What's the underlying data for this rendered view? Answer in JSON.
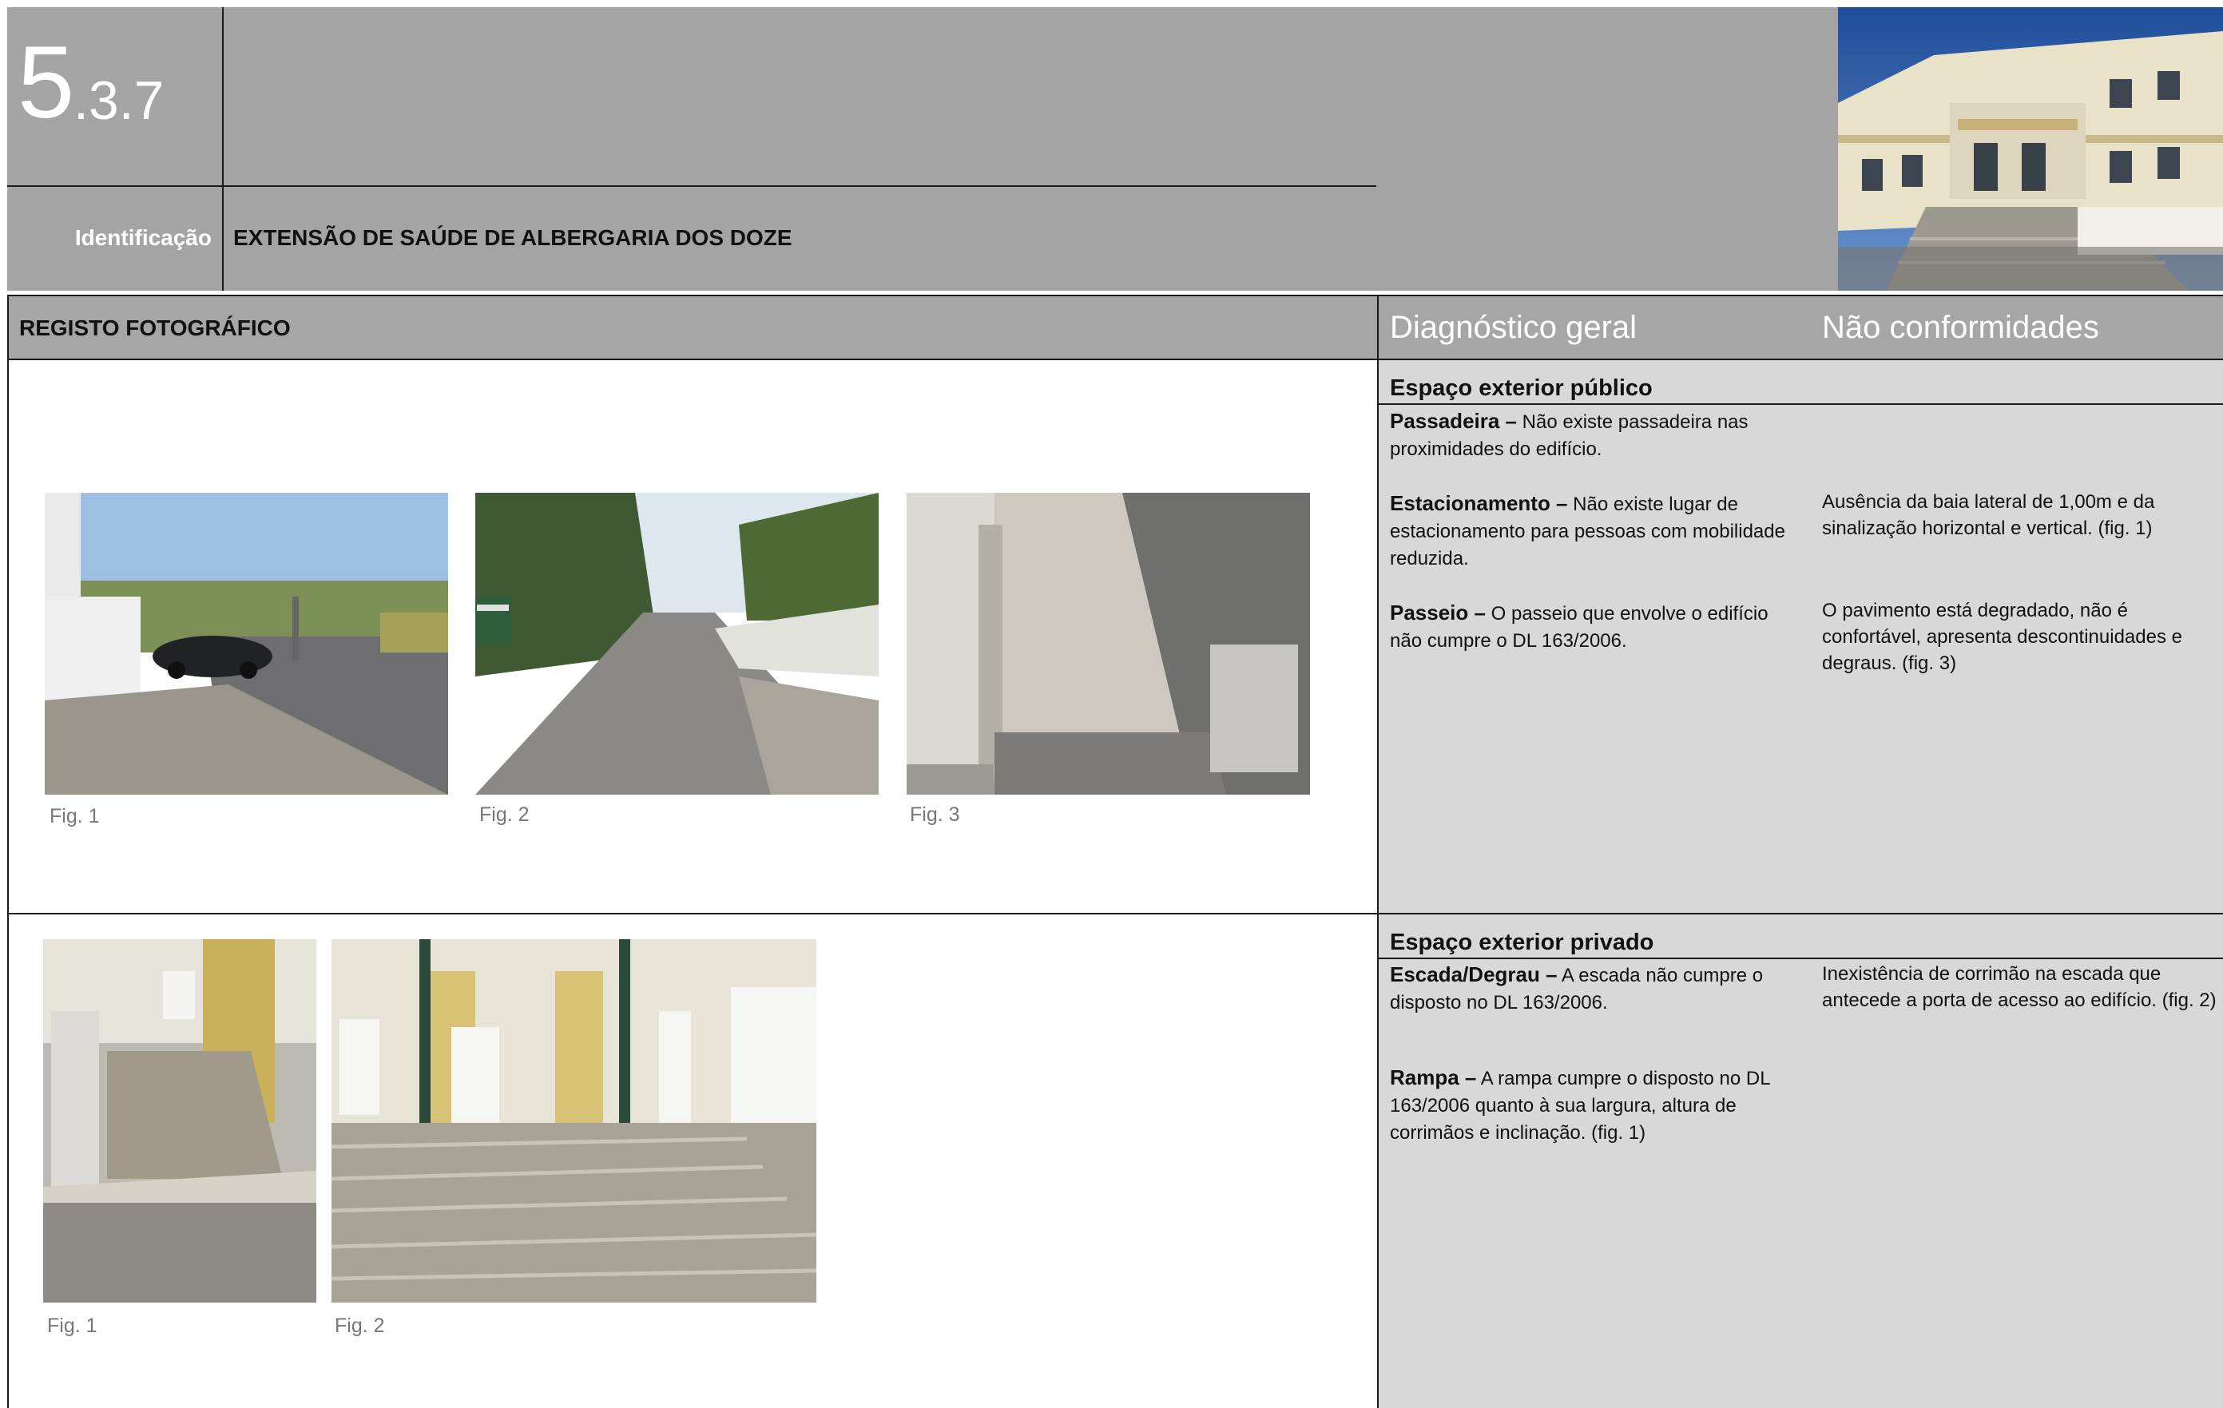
{
  "header": {
    "section_number": "5",
    "section_sub": ".3.7",
    "identification_label": "Identificação",
    "identification_value": "EXTENSÃO DE SAÚDE DE ALBERGARIA DOS DOZE"
  },
  "table": {
    "photo_column_title": "REGISTO FOTOGRÁFICO",
    "diagnosis_column_title": "Diagnóstico geral",
    "nonconformity_column_title": "Não conformidades"
  },
  "public_section": {
    "title": "Espaço exterior público",
    "items": [
      {
        "term": "Passadeira –",
        "text": " Não existe passadeira nas proximidades do edifício.",
        "nonconformity": ""
      },
      {
        "term": "Estacionamento –",
        "text": " Não existe lugar de estacionamento para pessoas com mobilidade reduzida.",
        "nonconformity": "Ausência da baia lateral de 1,00m e da sinalização horizontal e vertical. (fig. 1)"
      },
      {
        "term": "Passeio –",
        "text": " O passeio que envolve o edifício não cumpre o DL 163/2006.",
        "nonconformity": "O pavimento está degradado, não é confortável, apresenta descontinuidades e degraus. (fig. 3)"
      }
    ],
    "figures": [
      "Fig. 1",
      "Fig. 2",
      "Fig. 3"
    ]
  },
  "private_section": {
    "title": "Espaço exterior privado",
    "items": [
      {
        "term": "Escada/Degrau –",
        "text": " A escada não cumpre o disposto no DL 163/2006.",
        "nonconformity": "Inexistência de corrimão na escada que antecede a porta de acesso ao edifício. (fig. 2)"
      },
      {
        "term": "Rampa –",
        "text": " A rampa cumpre o disposto no DL 163/2006 quanto à sua largura, altura de corrimãos e inclinação. (fig. 1)",
        "nonconformity": ""
      }
    ],
    "figures": [
      "Fig. 1",
      "Fig. 2"
    ]
  }
}
